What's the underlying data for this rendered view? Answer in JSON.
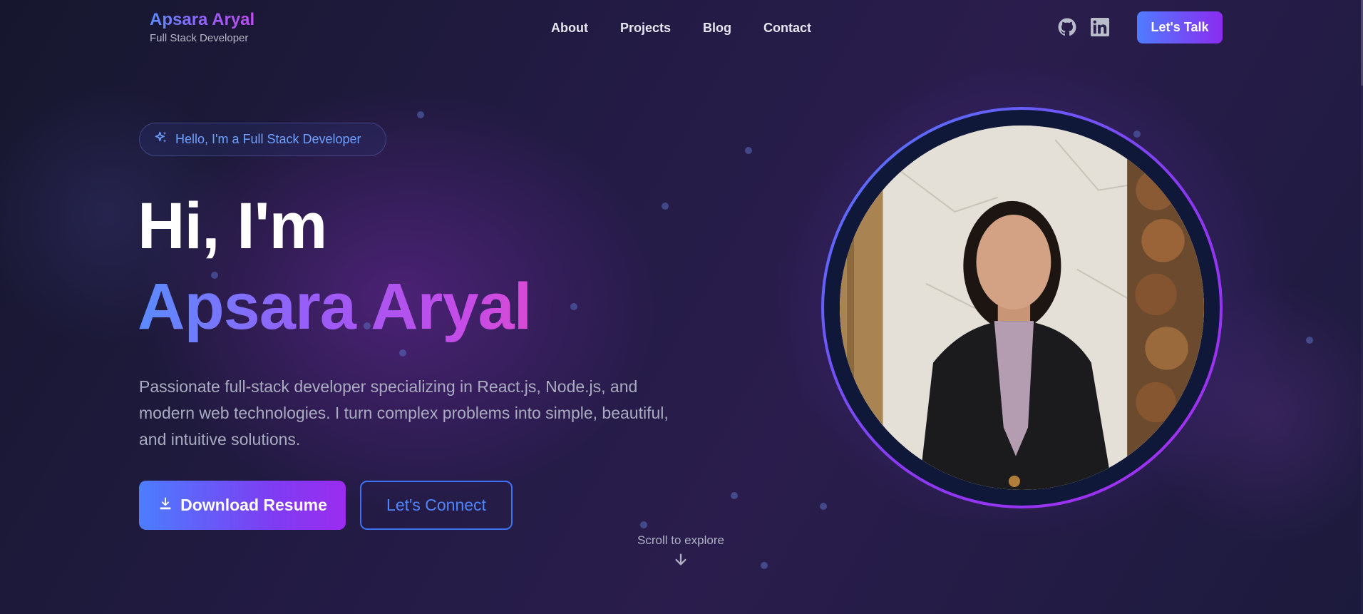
{
  "header": {
    "brand_name": "Apsara Aryal",
    "brand_subtitle": "Full Stack Developer",
    "nav": [
      {
        "label": "About"
      },
      {
        "label": "Projects"
      },
      {
        "label": "Blog"
      },
      {
        "label": "Contact"
      }
    ],
    "social": [
      {
        "icon": "github-icon"
      },
      {
        "icon": "linkedin-icon"
      }
    ],
    "cta_label": "Let's Talk"
  },
  "hero": {
    "badge_icon": "sparkles-icon",
    "badge_text": "Hello, I'm a Full Stack Developer",
    "greeting": "Hi, I'm",
    "name": "Apsara Aryal",
    "description": "Passionate full-stack developer specializing in React.js, Node.js, and modern web technologies. I turn complex problems into simple, beautiful, and intuitive solutions.",
    "primary_button": {
      "label": "Download Resume",
      "icon": "download-icon"
    },
    "secondary_button": {
      "label": "Let's Connect"
    },
    "scroll_hint": "Scroll to explore",
    "scroll_icon": "arrow-down-icon"
  },
  "portrait": {
    "image": "profile-photo"
  },
  "colors": {
    "accent_blue": "#4f7cff",
    "accent_purple": "#8a2cf0",
    "background": "#1f1a3d"
  }
}
